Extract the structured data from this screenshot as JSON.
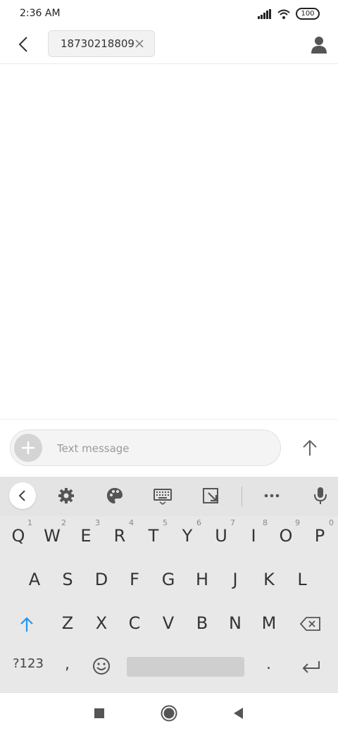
{
  "status_bar": {
    "time": "2:36 AM",
    "battery": "100"
  },
  "header": {
    "recipient": "18730218809"
  },
  "composer": {
    "placeholder": "Text message"
  },
  "keyboard": {
    "row1": [
      {
        "key": "Q",
        "hint": "1"
      },
      {
        "key": "W",
        "hint": "2"
      },
      {
        "key": "E",
        "hint": "3"
      },
      {
        "key": "R",
        "hint": "4"
      },
      {
        "key": "T",
        "hint": "5"
      },
      {
        "key": "Y",
        "hint": "6"
      },
      {
        "key": "U",
        "hint": "7"
      },
      {
        "key": "I",
        "hint": "8"
      },
      {
        "key": "O",
        "hint": "9"
      },
      {
        "key": "P",
        "hint": "0"
      }
    ],
    "row2": [
      "A",
      "S",
      "D",
      "F",
      "G",
      "H",
      "J",
      "K",
      "L"
    ],
    "row3": [
      "Z",
      "X",
      "C",
      "V",
      "B",
      "N",
      "M"
    ],
    "symbols_label": "?123",
    "comma": ",",
    "period": "."
  },
  "colors": {
    "accent": "#2196f3",
    "icon": "#555555",
    "keyboard_bg": "#e8e8e8"
  }
}
